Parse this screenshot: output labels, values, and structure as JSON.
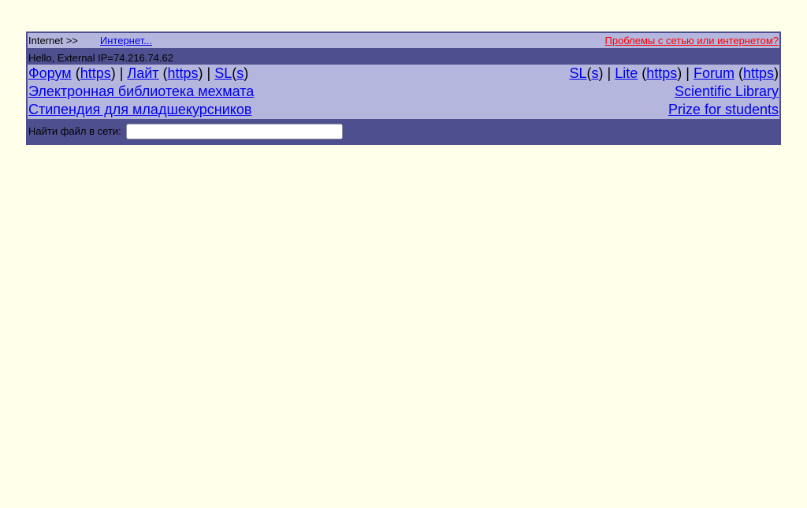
{
  "top_bar": {
    "internet_label": "Internet >>",
    "internet_link": "Интернет...",
    "problems_link": "Проблемы с сетью или интернетом?"
  },
  "hello_bar": {
    "text": "Hello, External IP=74.216.74.62"
  },
  "nav_left_1": {
    "forum": "Форум",
    "forum_https": "https",
    "lite": "Лайт",
    "lite_https": "https",
    "sl": "SL",
    "sl_s": "s"
  },
  "nav_right_1": {
    "sl": "SL",
    "sl_s": "s",
    "lite": "Lite",
    "lite_https": "https",
    "forum": "Forum",
    "forum_https": "https"
  },
  "nav_row_2": {
    "left": "Электронная библиотека мехмата",
    "right": "Scientific Library"
  },
  "nav_row_3": {
    "left": "Стипендия для младшекурсников",
    "right": "Prize for students"
  },
  "search": {
    "label": "Найти файл в сети:",
    "value": "",
    "placeholder": ""
  },
  "colors": {
    "background": "#ffffea",
    "panel_light": "#b4b6dd",
    "panel_dark": "#4e4f8f",
    "link": "#0000ee",
    "alert_link": "#ff0000"
  }
}
